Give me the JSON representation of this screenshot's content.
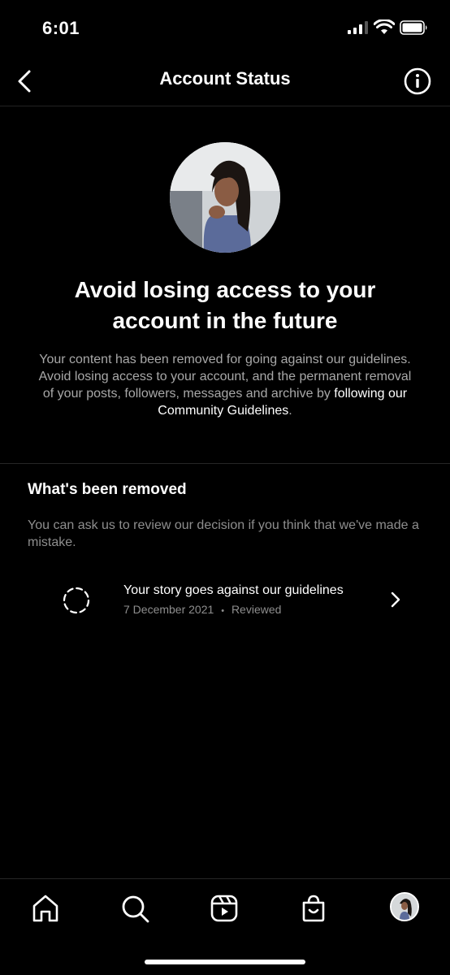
{
  "status_bar": {
    "time": "6:01"
  },
  "header": {
    "title": "Account Status"
  },
  "hero": {
    "headline": "Avoid losing access to your account in the future",
    "body_prefix": "Your content has been removed for going against our guidelines. Avoid losing access to your account, and the permanent removal of your posts, followers, messages and archive by ",
    "body_link": "following our Community Guidelines",
    "body_suffix": "."
  },
  "removed_section": {
    "title": "What's been removed",
    "description": "You can ask us to review our decision if you think that we've made a mistake.",
    "items": [
      {
        "title": "Your story goes against our guidelines",
        "date": "7 December 2021",
        "separator": "•",
        "status": "Reviewed"
      }
    ]
  },
  "tabbar": {
    "tabs": [
      {
        "icon": "home-icon"
      },
      {
        "icon": "search-icon"
      },
      {
        "icon": "reels-icon"
      },
      {
        "icon": "shop-icon"
      },
      {
        "icon": "profile-avatar"
      }
    ]
  }
}
